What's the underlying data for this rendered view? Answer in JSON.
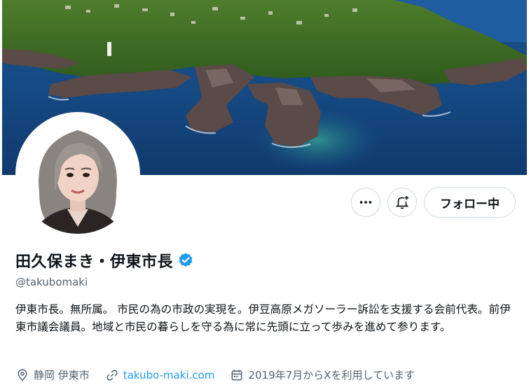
{
  "profile": {
    "display_name": "田久保まき・伊東市長",
    "handle": "@takubomaki",
    "bio": "伊東市長。無所属。 市民の為の市政の実現を。伊豆高原メガソーラー訴訟を支援する会前代表。前伊東市議会議員。地域と市民の暮らしを守る為に常に先頭に立って歩みを進めて参ります。",
    "location": "静岡 伊東市",
    "website": "takubo-maki.com",
    "joined": "2019年7月からXを利用しています"
  },
  "actions": {
    "follow_label": "フォロー中"
  },
  "icons": {
    "more": "more-icon",
    "notify": "bell-plus-icon",
    "verified": "verified-badge-icon",
    "location": "location-pin-icon",
    "link": "link-icon",
    "calendar": "calendar-icon"
  },
  "colors": {
    "accent": "#1d9bf0",
    "secondary_text": "#536471",
    "border": "#cfd9de"
  }
}
